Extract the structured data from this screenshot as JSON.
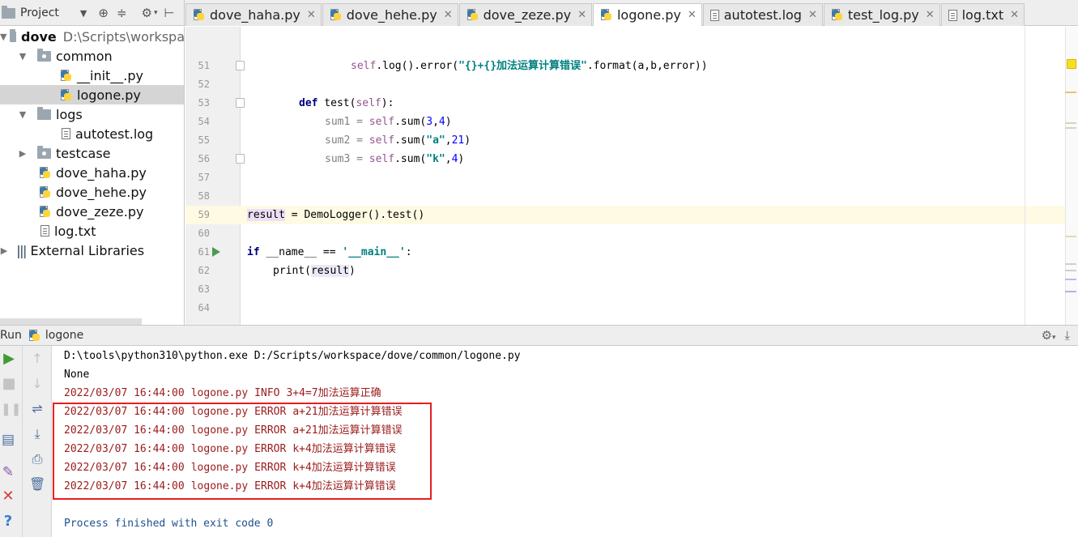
{
  "project_toolbar": {
    "title": "Project",
    "dropdown_icon": "triangle-down",
    "buttons": [
      "target-icon",
      "collapse-icon",
      "gear-icon",
      "hide-icon"
    ]
  },
  "tabs": [
    {
      "label": "dove_haha.py",
      "icon": "python-file-icon",
      "active": false
    },
    {
      "label": "dove_hehe.py",
      "icon": "python-file-icon",
      "active": false
    },
    {
      "label": "dove_zeze.py",
      "icon": "python-file-icon",
      "active": false
    },
    {
      "label": "logone.py",
      "icon": "python-file-icon",
      "active": true
    },
    {
      "label": "autotest.log",
      "icon": "text-file-icon",
      "active": false
    },
    {
      "label": "test_log.py",
      "icon": "python-file-icon",
      "active": false
    },
    {
      "label": "log.txt",
      "icon": "text-file-icon",
      "active": false
    }
  ],
  "tree": {
    "root_name": "dove",
    "root_path": "D:\\Scripts\\workspa",
    "common": "common",
    "init_file": "__init__.py",
    "logone": "logone.py",
    "logs": "logs",
    "autotest": "autotest.log",
    "testcase": "testcase",
    "haha": "dove_haha.py",
    "hehe": "dove_hehe.py",
    "zeze": "dove_zeze.py",
    "logtxt": "log.txt",
    "external": "External Libraries"
  },
  "editor": {
    "line_numbers": [
      "51",
      "52",
      "53",
      "54",
      "55",
      "56",
      "57",
      "58",
      "59",
      "60",
      "61",
      "62",
      "63",
      "64"
    ],
    "l51": {
      "self": "self",
      "a": ".log().error(",
      "s": "\"{}+{}加法运算计算错误\"",
      "b": ".format(a,b,error))"
    },
    "l53": {
      "kw": "def",
      "a": " test(",
      "p": "self",
      "b": "):"
    },
    "l54": {
      "a": "sum1 = ",
      "self": "self",
      "b": ".sum(",
      "n1": "3",
      "c": ",",
      "n2": "4",
      "d": ")"
    },
    "l55": {
      "a": "sum2 = ",
      "self": "self",
      "b": ".sum(",
      "s": "\"a\"",
      "c": ",",
      "n": "21",
      "d": ")"
    },
    "l56": {
      "a": "sum3 = ",
      "self": "self",
      "b": ".sum(",
      "s": "\"k\"",
      "c": ",",
      "n": "4",
      "d": ")"
    },
    "l59": {
      "var": "result",
      "a": " = DemoLogger().test()"
    },
    "l61": {
      "kw": "if",
      "a": " __name__ == ",
      "s": "'__main__'",
      "b": ":"
    },
    "l62": {
      "a": "print(",
      "var": "result",
      "b": ")"
    }
  },
  "run": {
    "label": "Run",
    "config": "logone",
    "console": {
      "command": "D:\\tools\\python310\\python.exe D:/Scripts/workspace/dove/common/logone.py",
      "output": "None",
      "logs": [
        {
          "time": "2022/03/07 16:44:00",
          "file": "logone.py",
          "level": "INFO",
          "message": "3+4=7加法运算正确"
        },
        {
          "time": "2022/03/07 16:44:00",
          "file": "logone.py",
          "level": "ERROR",
          "message": "a+21加法运算计算错误"
        },
        {
          "time": "2022/03/07 16:44:00",
          "file": "logone.py",
          "level": "ERROR",
          "message": "a+21加法运算计算错误"
        },
        {
          "time": "2022/03/07 16:44:00",
          "file": "logone.py",
          "level": "ERROR",
          "message": "k+4加法运算计算错误"
        },
        {
          "time": "2022/03/07 16:44:00",
          "file": "logone.py",
          "level": "ERROR",
          "message": "k+4加法运算计算错误"
        },
        {
          "time": "2022/03/07 16:44:00",
          "file": "logone.py",
          "level": "ERROR",
          "message": "k+4加法运算计算错误"
        }
      ],
      "exit": "Process finished with exit code 0"
    }
  },
  "colors": {
    "log_text": "#9b1b1b",
    "highlight_box": "#e81e1e",
    "current_line": "#fffae3",
    "run_green": "#499c54"
  }
}
